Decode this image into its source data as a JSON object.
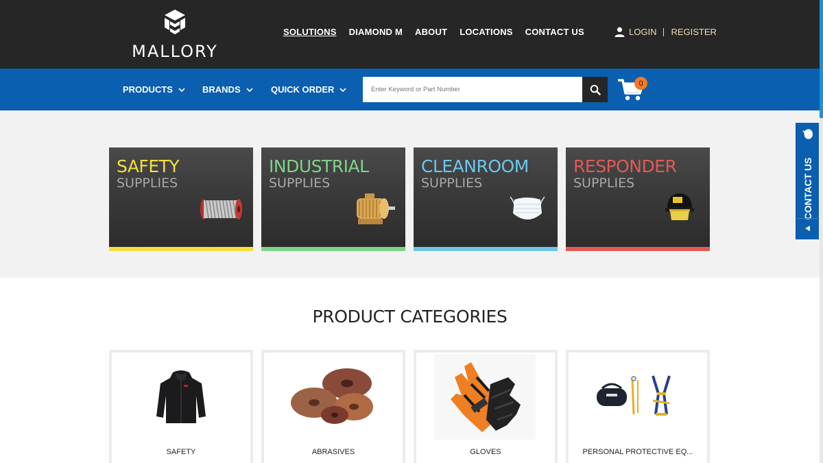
{
  "brand": {
    "name": "MALLORY"
  },
  "topnav": {
    "items": [
      {
        "label": "SOLUTIONS",
        "active": true
      },
      {
        "label": "DIAMOND M"
      },
      {
        "label": "ABOUT"
      },
      {
        "label": "LOCATIONS"
      },
      {
        "label": "CONTACT US"
      }
    ]
  },
  "account": {
    "login": "LOGIN",
    "register": "REGISTER",
    "icon": "user-icon"
  },
  "menu": {
    "products": "PRODUCTS",
    "brands": "BRANDS",
    "quick_order": "QUICK ORDER"
  },
  "search": {
    "placeholder": "Enter Keyword or Part Number",
    "icon": "search-icon"
  },
  "cart": {
    "count": "0",
    "icon": "cart-icon"
  },
  "solutions": [
    {
      "line1": "SAFETY",
      "line2": "SUPPLIES",
      "color": "#f5e03a",
      "icon": "wire-spool-icon"
    },
    {
      "line1": "INDUSTRIAL",
      "line2": "SUPPLIES",
      "color": "#7ed38a",
      "icon": "electric-motor-icon"
    },
    {
      "line1": "CLEANROOM",
      "line2": "SUPPLIES",
      "color": "#6cc6ec",
      "icon": "face-mask-icon"
    },
    {
      "line1": "RESPONDER",
      "line2": "SUPPLIES",
      "color": "#e25a54",
      "icon": "fire-helmet-icon"
    }
  ],
  "contact_tab": {
    "label": "CONTACT US"
  },
  "categories": {
    "title": "PRODUCT CATEGORIES",
    "items": [
      {
        "name": "SAFETY",
        "icon": "jacket-icon"
      },
      {
        "name": "ABRASIVES",
        "icon": "abrasive-discs-icon"
      },
      {
        "name": "GLOVES",
        "icon": "gloves-icon"
      },
      {
        "name": "PERSONAL PROTECTIVE EQ...",
        "icon": "harness-kit-icon"
      }
    ]
  }
}
